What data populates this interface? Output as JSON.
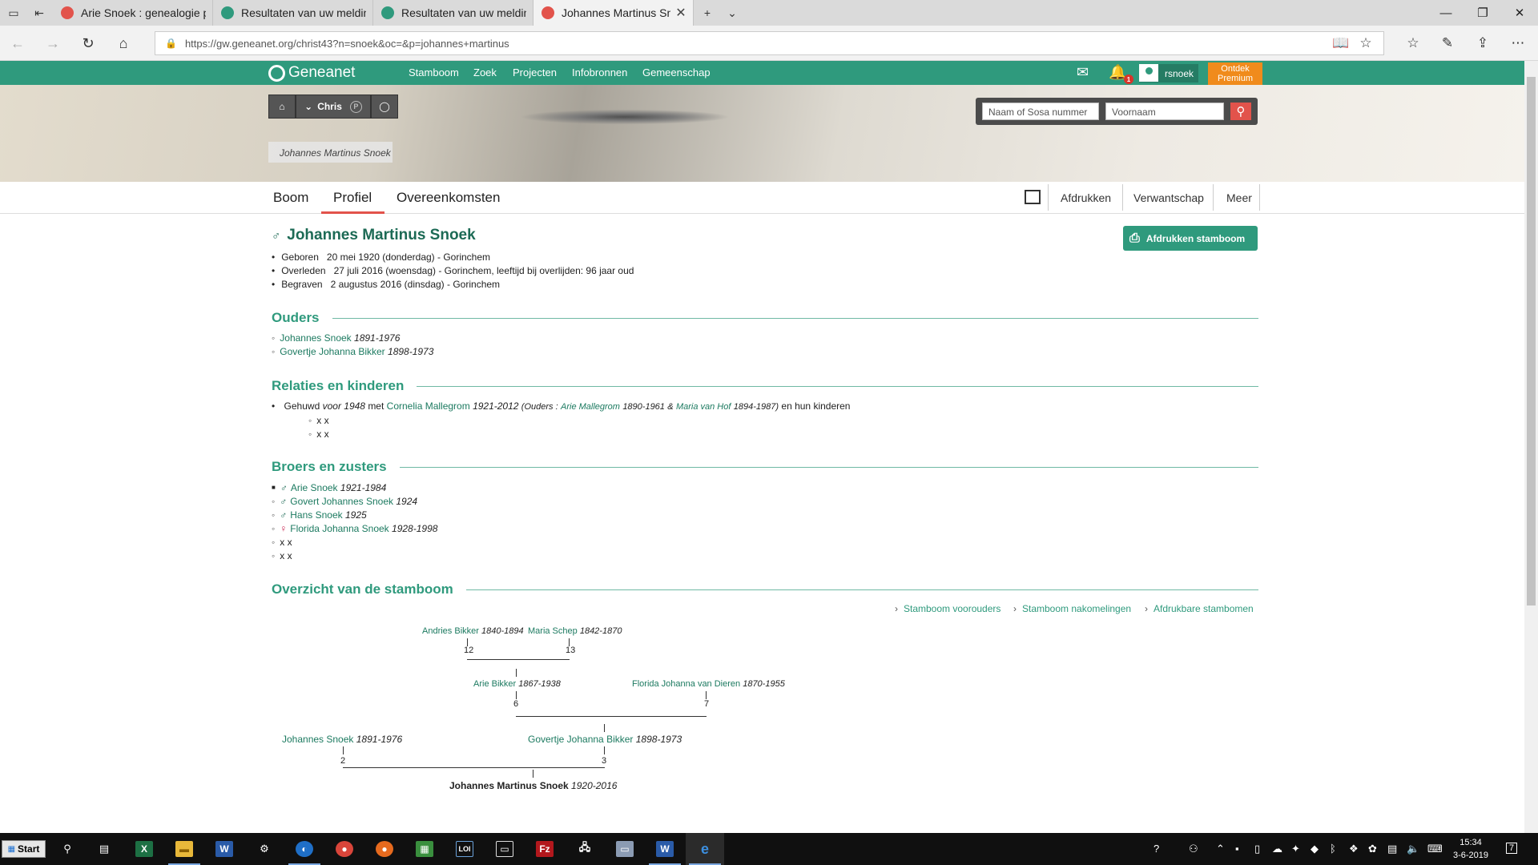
{
  "browser": {
    "tabs": [
      {
        "title": "Arie Snoek : genealogie per",
        "icon_color": "#e2534b",
        "active": false
      },
      {
        "title": "Resultaten van uw meldinge",
        "icon_color": "#2f9a7d",
        "active": false
      },
      {
        "title": "Resultaten van uw meldinge",
        "icon_color": "#2f9a7d",
        "active": false
      },
      {
        "title": "Johannes Martinus Sno",
        "icon_color": "#e2534b",
        "active": true
      }
    ],
    "url": "https://gw.geneanet.org/christ43?n=snoek&oc=&p=johannes+martinus"
  },
  "site": {
    "logo": "Geneanet",
    "nav": [
      "Stamboom",
      "Zoek",
      "Projecten",
      "Infobronnen",
      "Gemeenschap"
    ],
    "notification_count": "1",
    "username": "rsnoek",
    "premium_line1": "Ontdek",
    "premium_line2": "Premium",
    "owner_button": "Chris",
    "banner_caption": "Johannes Martinus Snoek",
    "search_placeholder_sosa": "Naam of Sosa nummer",
    "search_placeholder_firstname": "Voornaam"
  },
  "subnav": {
    "tabs": [
      "Boom",
      "Profiel",
      "Overeenkomsten"
    ],
    "right": [
      "Afdrukken",
      "Verwantschap",
      "Meer"
    ]
  },
  "person": {
    "name": "Johannes Martinus Snoek",
    "print_button": "Afdrukken stamboom",
    "facts": [
      {
        "label": "Geboren",
        "value": "20 mei 1920 (donderdag) - Gorinchem"
      },
      {
        "label": "Overleden",
        "value": "27 juli 2016 (woensdag) - Gorinchem, leeftijd bij overlijden: 96 jaar oud"
      },
      {
        "label": "Begraven",
        "value": "2 augustus 2016 (dinsdag) - Gorinchem"
      }
    ]
  },
  "parents": {
    "heading": "Ouders",
    "items": [
      {
        "name": "Johannes Snoek",
        "years": "1891-1976"
      },
      {
        "name": "Govertje Johanna Bikker",
        "years": "1898-1973"
      }
    ]
  },
  "relations": {
    "heading": "Relaties en kinderen",
    "married_prefix": "Gehuwd",
    "married_when": "voor 1948",
    "married_with": "met",
    "spouse": "Cornelia Mallegrom",
    "spouse_years": "1921-2012",
    "parents_open": "(Ouders :",
    "spouse_father": "Arie Mallegrom",
    "spouse_father_years": "1890-1961",
    "amp": "&",
    "spouse_mother": "Maria van Hof",
    "spouse_mother_years": "1894-1987)",
    "children_suffix": "en hun kinderen",
    "children": [
      "x x",
      "x x"
    ]
  },
  "siblings": {
    "heading": "Broers en zusters",
    "items": [
      {
        "sex": "♂",
        "name": "Arie Snoek",
        "years": "1921-1984"
      },
      {
        "sex": "♂",
        "name": "Govert Johannes Snoek",
        "years": "1924"
      },
      {
        "sex": "♂",
        "name": "Hans Snoek",
        "years": "1925"
      },
      {
        "sex": "♀",
        "name": "Florida Johanna Snoek",
        "years": "1928-1998"
      },
      {
        "sex": "",
        "name": "x x",
        "years": ""
      },
      {
        "sex": "",
        "name": "x x",
        "years": ""
      }
    ]
  },
  "overview": {
    "heading": "Overzicht van de stamboom",
    "links": [
      "Stamboom voorouders",
      "Stamboom nakomelingen",
      "Afdrukbare stambomen"
    ],
    "tree": {
      "p12": {
        "name": "Andries Bikker",
        "years": "1840-1894",
        "num": "12"
      },
      "p13": {
        "name": "Maria Schep",
        "years": "1842-1870",
        "num": "13"
      },
      "p6": {
        "name": "Arie Bikker",
        "years": "1867-1938",
        "num": "6"
      },
      "p7": {
        "name": "Florida Johanna van Dieren",
        "years": "1870-1955",
        "num": "7"
      },
      "p2": {
        "name": "Johannes Snoek",
        "years": "1891-1976",
        "num": "2"
      },
      "p3": {
        "name": "Govertje Johanna Bikker",
        "years": "1898-1973",
        "num": "3"
      },
      "p1": {
        "name": "Johannes Martinus Snoek",
        "years": "1920-2016"
      }
    }
  },
  "taskbar": {
    "start": "Start",
    "time": "15:34",
    "date": "3-6-2019",
    "notif": "7"
  },
  "colors": {
    "brand_green": "#2f9a7d",
    "link_green": "#1c7a60",
    "accent_red": "#e2534b",
    "premium_orange": "#f08b1c"
  }
}
